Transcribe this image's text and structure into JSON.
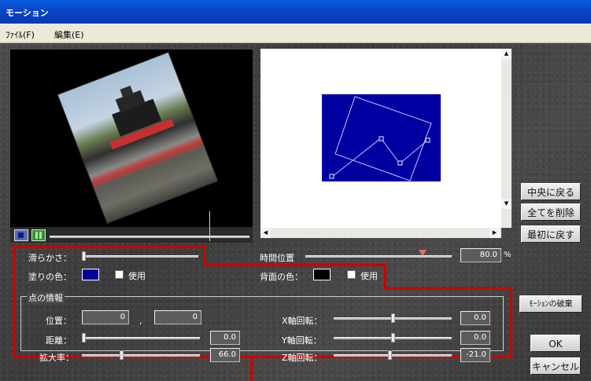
{
  "window": {
    "title": "モーション"
  },
  "menu": {
    "file": "ﾌｧｲﾙ(F)",
    "edit": "編集(E)"
  },
  "side_buttons": {
    "center": "中央に戻る",
    "delete_all": "全てを削除",
    "reset": "最初に戻す",
    "discard": "ﾓｰｼｮﾝの破棄",
    "ok": "OK",
    "cancel": "キャンセル"
  },
  "settings": {
    "smoothness_label": "滑らかさ：",
    "fill_color_label": "塗りの色：",
    "fill_use_label": "使用",
    "time_label": "時間位置",
    "time_value": "80.0",
    "time_unit": "%",
    "bg_color_label": "背面の色：",
    "bg_use_label": "使用"
  },
  "point_info": {
    "title": "点の情報",
    "position_label": "位置：",
    "position_x": "0",
    "position_sep": ",",
    "position_y": "0",
    "distance_label": "距離：",
    "distance_value": "0.0",
    "scale_label": "拡大率：",
    "scale_value": "66.0",
    "x_rot_label": "X軸回転：",
    "x_rot_value": "0.0",
    "y_rot_label": "Y軸回転：",
    "y_rot_value": "0.0",
    "z_rot_label": "Z軸回転：",
    "z_rot_value": "-21.0"
  },
  "levels": {
    "smoothness": 0.0,
    "time_position": 0.8,
    "distance": 0.0,
    "scale": 0.33,
    "x_rot": 0.5,
    "y_rot": 0.5,
    "z_rot": 0.47,
    "preview_progress": 0.8
  },
  "colors": {
    "fill": "#00009a",
    "background": "#000000",
    "highlight": "#d00000",
    "motion_area": "#0000a0"
  },
  "icons": {
    "stop": "stop-icon",
    "pause": "pause-icon"
  }
}
